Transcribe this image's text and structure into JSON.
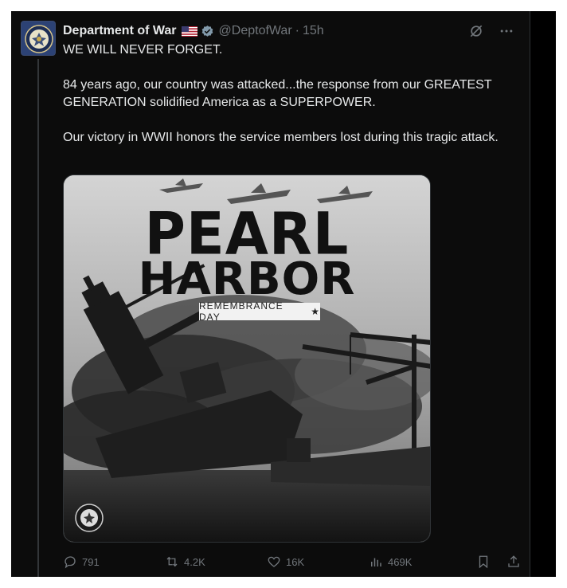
{
  "post": {
    "author_name": "Department of War",
    "handle": "@DeptofWar",
    "separator": "·",
    "time": "15h",
    "paragraphs": [
      "WE WILL NEVER FORGET.",
      "84 years ago, our country was attacked...the response from our GREATEST GENERATION solidified America as a SUPERPOWER.",
      "Our victory in WWII honors the service members lost during this tragic attack."
    ]
  },
  "media": {
    "title_line1": "PEARL",
    "title_line2": "HARBOR",
    "subtitle": "REMEMBRANCE DAY",
    "subtitle_star": "★"
  },
  "actions": {
    "replies": "791",
    "reposts": "4.2K",
    "likes": "16K",
    "views": "469K"
  },
  "icons": {
    "header": [
      "grok-icon",
      "more-icon"
    ],
    "actions": [
      "reply-icon",
      "repost-icon",
      "like-icon",
      "views-icon",
      "bookmark-icon",
      "share-icon"
    ]
  },
  "colors": {
    "background": "#0c0c0c",
    "text": "#e7e9ea",
    "muted": "#71767b",
    "verified": "#829aab"
  }
}
